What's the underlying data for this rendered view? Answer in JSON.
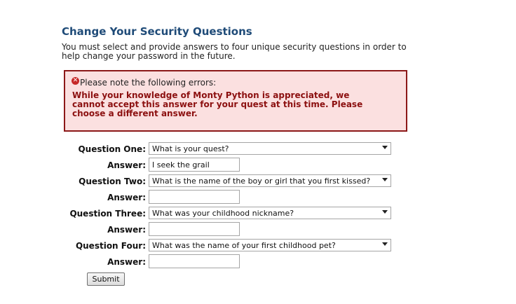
{
  "page": {
    "title": "Change Your Security Questions",
    "intro": "You must select and provide answers to four unique security questions in order to help change your password in the future."
  },
  "error": {
    "icon": "error-circle-icon",
    "heading": "Please note the following errors:",
    "message": "While your knowledge of Monty Python is appreciated, we cannot accept this answer for your quest at this time. Please choose a different answer."
  },
  "form": {
    "answer_label": "Answer:",
    "questions": [
      {
        "label": "Question One:",
        "selected": "What is your quest?",
        "answer": "I seek the grail"
      },
      {
        "label": "Question Two:",
        "selected": "What is the name of the boy or girl that you first kissed?",
        "answer": ""
      },
      {
        "label": "Question Three:",
        "selected": "What was your childhood nickname?",
        "answer": ""
      },
      {
        "label": "Question Four:",
        "selected": "What was the name of your first childhood pet?",
        "answer": ""
      }
    ],
    "submit_label": "Submit"
  },
  "colors": {
    "title": "#1f4b78",
    "error_border": "#8c1818",
    "error_background": "#fbe0e0",
    "error_text": "#8c1010"
  }
}
